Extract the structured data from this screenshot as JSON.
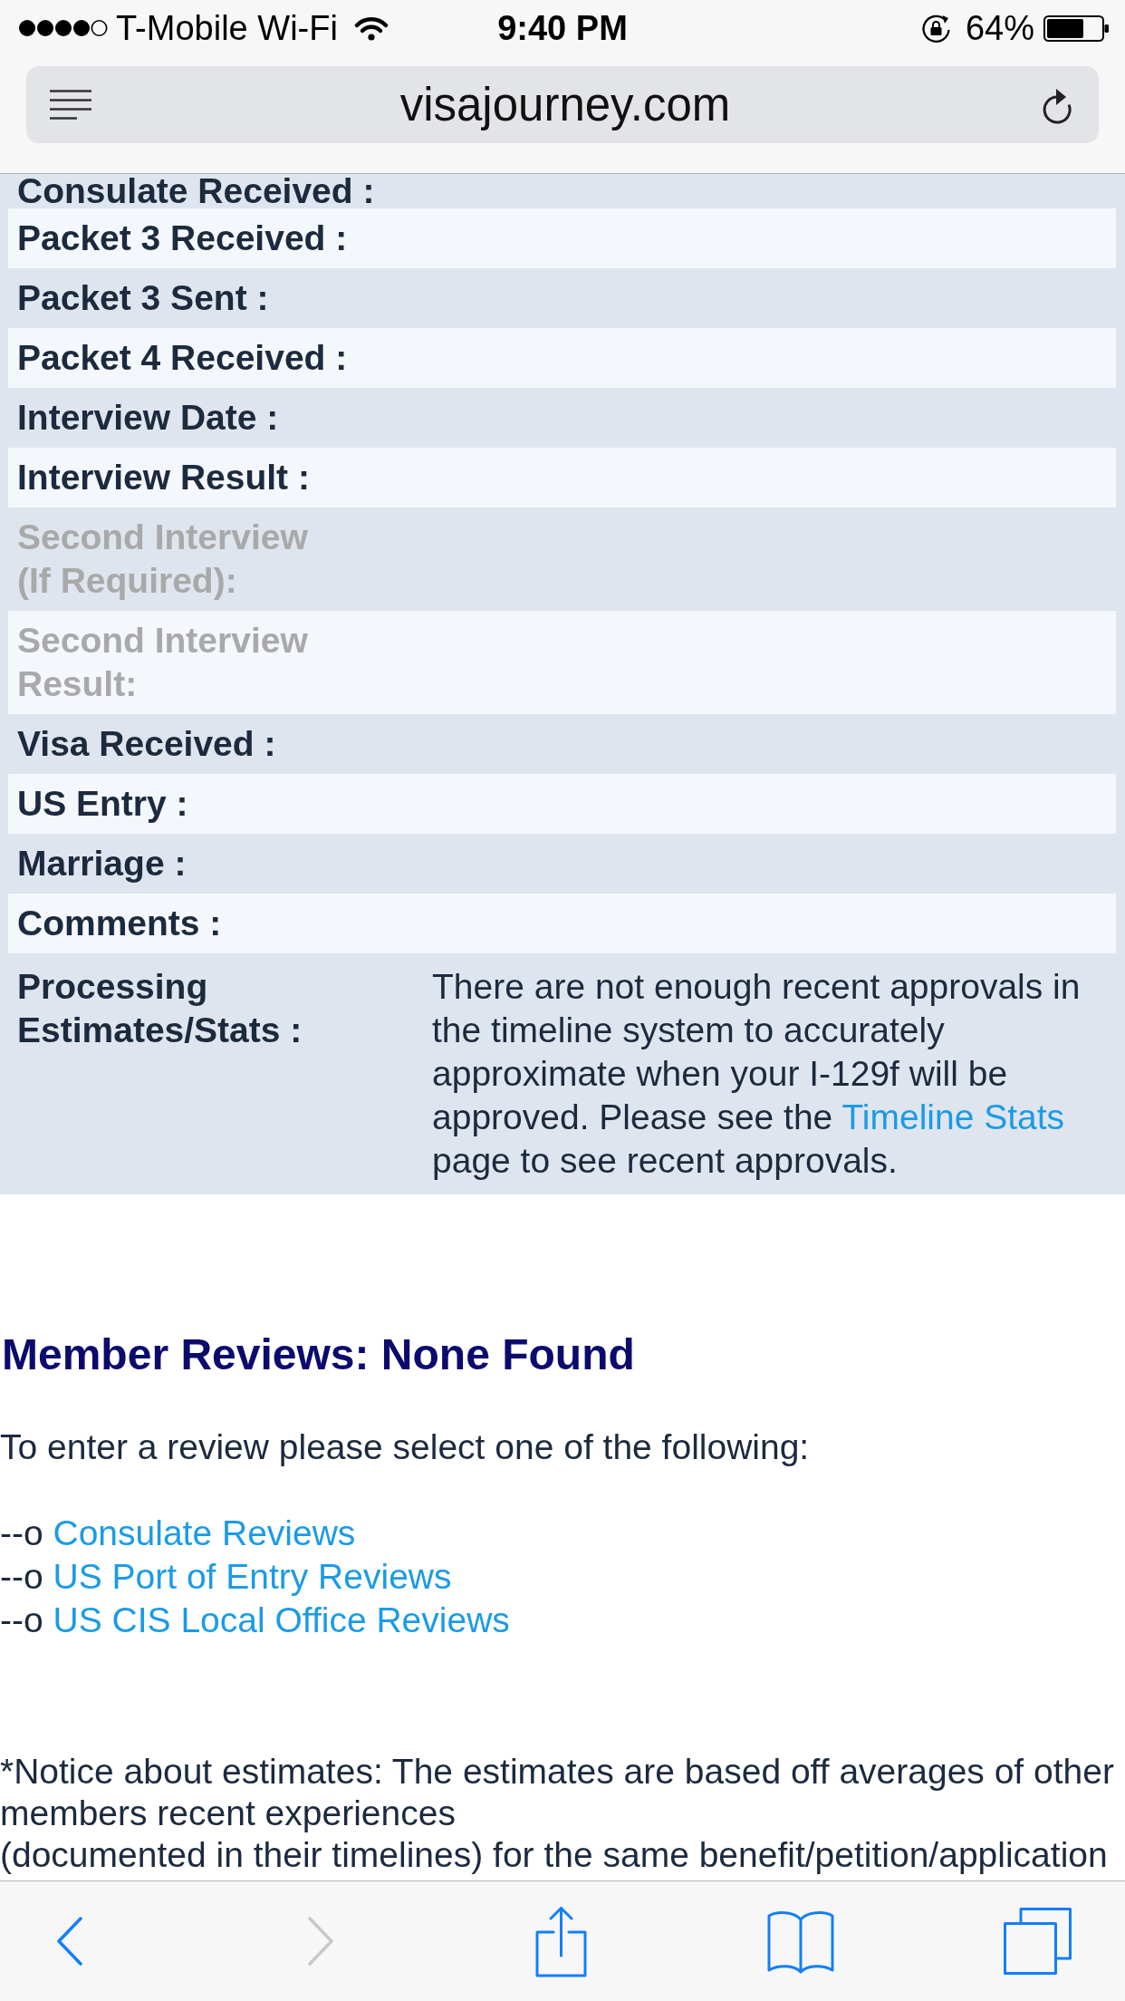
{
  "status_bar": {
    "carrier": "T-Mobile Wi-Fi",
    "time": "9:40 PM",
    "battery": "64%"
  },
  "address_bar": {
    "url": "visajourney.com"
  },
  "timeline": {
    "rows": [
      {
        "label": "Consulate Received :",
        "disabled": false
      },
      {
        "label": "Packet 3 Received :",
        "disabled": false
      },
      {
        "label": "Packet 3 Sent :",
        "disabled": false
      },
      {
        "label": "Packet 4 Received :",
        "disabled": false
      },
      {
        "label": "Interview Date :",
        "disabled": false
      },
      {
        "label": "Interview Result :",
        "disabled": false
      },
      {
        "label": "Second Interview\n(If Required):",
        "disabled": true
      },
      {
        "label": "Second Interview\nResult:",
        "disabled": true
      },
      {
        "label": "Visa Received :",
        "disabled": false
      },
      {
        "label": "US Entry :",
        "disabled": false
      },
      {
        "label": "Marriage :",
        "disabled": false
      },
      {
        "label": "Comments :",
        "disabled": false
      },
      {
        "label": "Processing\nEstimates/Stats :",
        "disabled": false,
        "value": {
          "text": "There are not enough recent approvals in the timeline system to accurately approximate when your I-129f will be approved. Please see the",
          "link": "Timeline Stats",
          "text_after": "page to see recent approvals."
        }
      }
    ]
  },
  "member_reviews": {
    "heading": "Member Reviews: None Found",
    "intro": "To enter a review please select one of the following:",
    "links": [
      {
        "prefix": "--o",
        "label": "Consulate Reviews"
      },
      {
        "prefix": "--o",
        "label": "US Port of Entry Reviews"
      },
      {
        "prefix": "--o",
        "label": "US CIS Local Office Reviews"
      }
    ]
  },
  "notice": "*Notice about estimates: The estimates are based off averages of other members recent experiences\n(documented in their timelines) for the same benefit/petition/application",
  "toolbar": {
    "back": {
      "disabled": false
    },
    "forward": {
      "disabled": true
    }
  }
}
